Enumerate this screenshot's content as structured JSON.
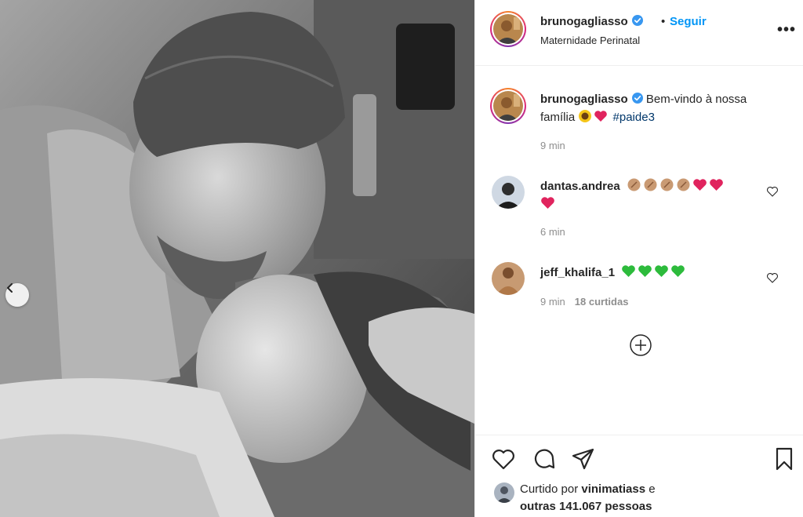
{
  "post": {
    "author": "brunogagliasso",
    "follow_label": "Seguir",
    "separator": "•",
    "location": "Maternidade Perinatal",
    "more_label": "•••"
  },
  "caption": {
    "author": "brunogagliasso",
    "text_part1": "Bem-vindo à nossa família",
    "hashtag": "#paide3",
    "time": "9 min"
  },
  "comments": [
    {
      "user": "dantas.andrea",
      "time": "6 min",
      "likes": ""
    },
    {
      "user": "jeff_khalifa_1",
      "time": "9 min",
      "likes": "18 curtidas"
    }
  ],
  "liked_by": {
    "prefix": "Curtido por",
    "user": "vinimatiass",
    "connector": "e",
    "others": "outras 141.067 pessoas"
  },
  "colors": {
    "accent": "#0095f6",
    "hashtag": "#00376b",
    "muted": "#8e8e8e",
    "text": "#262626",
    "border": "#efefef"
  },
  "icons": [
    "verified-badge-icon",
    "more-options-icon",
    "carousel-prev-icon",
    "heart-icon",
    "comment-icon",
    "share-icon",
    "bookmark-icon",
    "load-more-icon"
  ]
}
